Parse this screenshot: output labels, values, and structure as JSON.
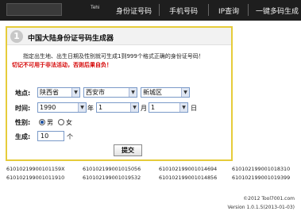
{
  "nav": {
    "logo_text": "Tehi",
    "items": [
      "身份证号码",
      "手机号码",
      "IP查询",
      "一键多码生成"
    ]
  },
  "panel": {
    "number": "1",
    "title": "中国大陆身份证号码生成器",
    "desc": "指定出生地、出生日期及性别就可生成1到999个格式正确的身份证号码！",
    "warning": "切记不可用于非法活动，否则后果自负！"
  },
  "form": {
    "location_label": "地点:",
    "province": "陕西省",
    "city": "西安市",
    "district": "新城区",
    "date_label": "时间:",
    "year": "1990",
    "year_unit": "年",
    "month": "1",
    "month_unit": "月",
    "day": "1",
    "day_unit": "日",
    "gender_label": "性别:",
    "male": "男",
    "female": "女",
    "count_label": "生成:",
    "count": "10",
    "count_unit": "个",
    "submit": "提交"
  },
  "results": [
    "61010219900101159X",
    "610102199001015056",
    "610102199001014694",
    "610102199001018310",
    "610102199001011910",
    "610102199001019532",
    "610102199001014856",
    "610102199001019399"
  ],
  "footer": {
    "copyright": "©2012 Tool7001.com",
    "version": "Version 1.0.1.5(2013-01-03)"
  }
}
